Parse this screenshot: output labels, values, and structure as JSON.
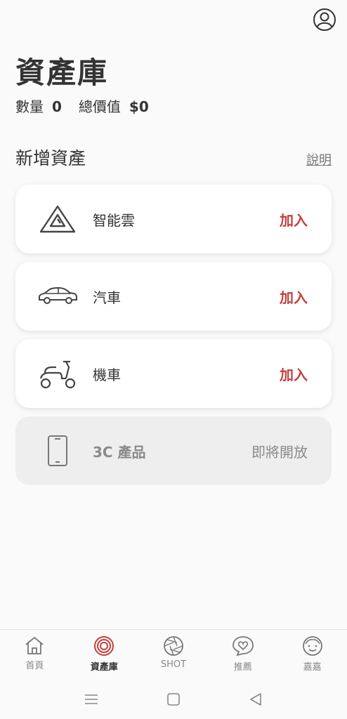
{
  "header": {
    "title": "資產庫",
    "quantity_label": "數量",
    "quantity_value": "0",
    "total_label": "總價值",
    "total_value": "$0"
  },
  "section": {
    "title": "新增資產",
    "help_link": "說明"
  },
  "assets": [
    {
      "label": "智能雲",
      "action": "加入",
      "icon": "cloud-triangle-icon",
      "enabled": true
    },
    {
      "label": "汽車",
      "action": "加入",
      "icon": "car-icon",
      "enabled": true
    },
    {
      "label": "機車",
      "action": "加入",
      "icon": "scooter-icon",
      "enabled": true
    },
    {
      "label": "3C 產品",
      "action": "即將開放",
      "icon": "phone-icon",
      "enabled": false
    }
  ],
  "bottom_nav": [
    {
      "label": "首頁",
      "icon": "home-icon",
      "active": false
    },
    {
      "label": "資產庫",
      "icon": "asset-ring-icon",
      "active": true
    },
    {
      "label": "SHOT",
      "icon": "camera-aperture-icon",
      "active": false
    },
    {
      "label": "推薦",
      "icon": "heart-bubble-icon",
      "active": false
    },
    {
      "label": "嘉嘉",
      "icon": "smiley-face-icon",
      "active": false
    }
  ],
  "system_bar": [
    "menu-icon",
    "home-square-icon",
    "back-triangle-icon"
  ],
  "colors": {
    "accent": "#c0423f",
    "text": "#333333",
    "muted": "#8a8a8a",
    "background": "#fafafa"
  }
}
